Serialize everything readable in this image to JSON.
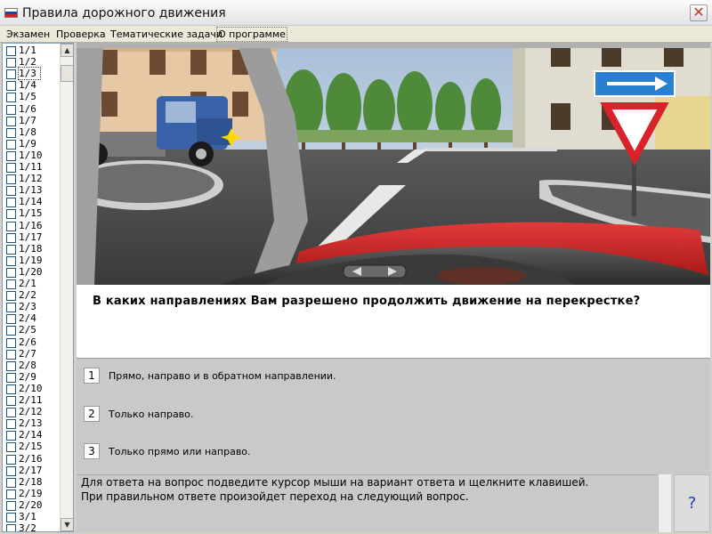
{
  "window": {
    "title": "Правила дорожного движения",
    "close_label": "✕"
  },
  "menu": [
    "Экзамен",
    "Проверка",
    "Тематические задачи",
    "О программе"
  ],
  "questions_list": {
    "items": [
      "1/1",
      "1/2",
      "1/3",
      "1/4",
      "1/5",
      "1/6",
      "1/7",
      "1/8",
      "1/9",
      "1/10",
      "1/11",
      "1/12",
      "1/13",
      "1/14",
      "1/15",
      "1/16",
      "1/17",
      "1/18",
      "1/19",
      "1/20",
      "2/1",
      "2/2",
      "2/3",
      "2/4",
      "2/5",
      "2/6",
      "2/7",
      "2/8",
      "2/9",
      "2/10",
      "2/11",
      "2/12",
      "2/13",
      "2/14",
      "2/15",
      "2/16",
      "2/17",
      "2/18",
      "2/19",
      "2/20",
      "3/1",
      "3/2"
    ],
    "selected": "1/3",
    "scroll_up": "▲",
    "scroll_down": "▼"
  },
  "question": {
    "text": "В каких направлениях Вам разрешено продолжить движение на перекрестке?"
  },
  "answers": [
    {
      "number": "1",
      "text": "Прямо, направо и в обратном направлении."
    },
    {
      "number": "2",
      "text": "Только направо."
    },
    {
      "number": "3",
      "text": "Только прямо или направо."
    }
  ],
  "hint": {
    "line1": "Для ответа на вопрос подведите курсор мыши на вариант ответа и щелкните клавишей.",
    "line2": "При правильном ответе произойдет переход на следующий вопрос."
  },
  "help_label": "?",
  "colors": {
    "flag_white": "#ffffff",
    "flag_blue": "#1f3fb5",
    "flag_red": "#d42020",
    "sign_red": "#d8232a",
    "sign_blue": "#2a7fd0",
    "car_red": "#d8262a",
    "truck_blue": "#3a62a8"
  }
}
